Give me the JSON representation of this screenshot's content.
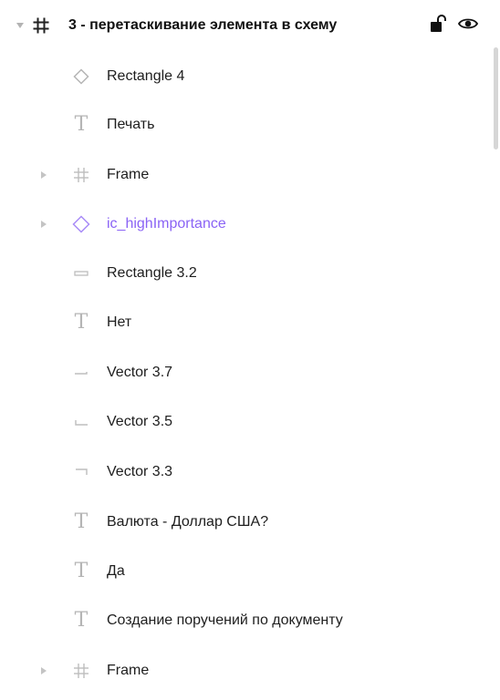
{
  "layers": {
    "root": {
      "label": "3 - перетаскивание элемента в схему",
      "icon": "frame-icon",
      "expanded": true,
      "locked": false,
      "visible": true
    },
    "items": [
      {
        "label": "Rectangle 4",
        "icon": "component-instance-icon",
        "has_children": false
      },
      {
        "label": "Печать",
        "icon": "text-icon",
        "has_children": false
      },
      {
        "label": "Frame",
        "icon": "frame-icon",
        "has_children": true
      },
      {
        "label": "ic_highImportance",
        "icon": "component-instance-icon",
        "has_children": true,
        "color": "#8a63f5"
      },
      {
        "label": "Rectangle 3.2",
        "icon": "rectangle-icon",
        "has_children": false
      },
      {
        "label": "Нет",
        "icon": "text-icon",
        "has_children": false
      },
      {
        "label": "Vector 3.7",
        "icon": "vector-line-icon",
        "has_children": false
      },
      {
        "label": "Vector 3.5",
        "icon": "vector-corner-icon",
        "has_children": false
      },
      {
        "label": "Vector 3.3",
        "icon": "vector-corner-icon",
        "has_children": false
      },
      {
        "label": "Валюта - Доллар США?",
        "icon": "text-icon",
        "has_children": false
      },
      {
        "label": "Да",
        "icon": "text-icon",
        "has_children": false
      },
      {
        "label": "Создание поручений по документу",
        "icon": "text-icon",
        "has_children": false
      },
      {
        "label": "Frame",
        "icon": "frame-icon",
        "has_children": true
      }
    ]
  },
  "colors": {
    "text": "#1e1e1e",
    "icon_gray": "#b5b5b5",
    "component_purple": "#8a63f5"
  }
}
